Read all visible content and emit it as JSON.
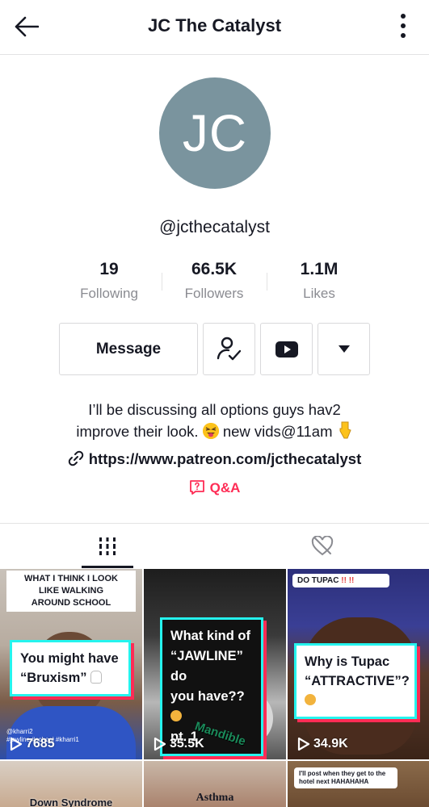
{
  "header": {
    "title": "JC The Catalyst",
    "back_icon": "arrow-left-icon",
    "more_icon": "vertical-dots-icon"
  },
  "profile": {
    "avatar_initials": "JC",
    "avatar_color": "#7a949e",
    "handle": "@jcthecatalyst",
    "stats": [
      {
        "value": "19",
        "label": "Following"
      },
      {
        "value": "66.5K",
        "label": "Followers"
      },
      {
        "value": "1.1M",
        "label": "Likes"
      }
    ],
    "message_label": "Message",
    "bio_line1": "I’ll be discussing all options guys hav2",
    "bio_line2a": "improve their look.",
    "bio_line2b": " new vids@11am",
    "link": "https://www.patreon.com/jcthecatalyst",
    "qa_label": "Q&A"
  },
  "tabs": {
    "videos_icon": "grid-bars-icon",
    "liked_icon": "heart-hidden-icon"
  },
  "videos": [
    {
      "banner": "WHAT I THINK I LOOK LIKE WALKING AROUND SCHOOL",
      "caption_line1": "You might have",
      "caption_line2": "“Bruxism”",
      "views": "7685",
      "credit": "@kharri2",
      "tags": "#jawline #school #kharri1"
    },
    {
      "caption_line1": "What kind of",
      "caption_line2": "“JAWLINE” do",
      "caption_line3": "you have??",
      "caption_line4": "pt. 1",
      "overlay_text": "Mandible",
      "views": "35.5K"
    },
    {
      "reply_text": "DO TUPAC",
      "caption_line1": "Why is Tupac",
      "caption_line2": "“ATTRACTIVE”?",
      "views": "34.9K"
    },
    {
      "overlay_text": "Down Syndrome"
    },
    {
      "overlay_text": "Asthma"
    },
    {
      "reply_text": "I'll post when they get to the hotel next HAHAHAHA"
    }
  ],
  "colors": {
    "accent_red": "#fe2c55",
    "accent_cyan": "#25f4ee",
    "text": "#161823",
    "muted": "#8a8b91"
  }
}
